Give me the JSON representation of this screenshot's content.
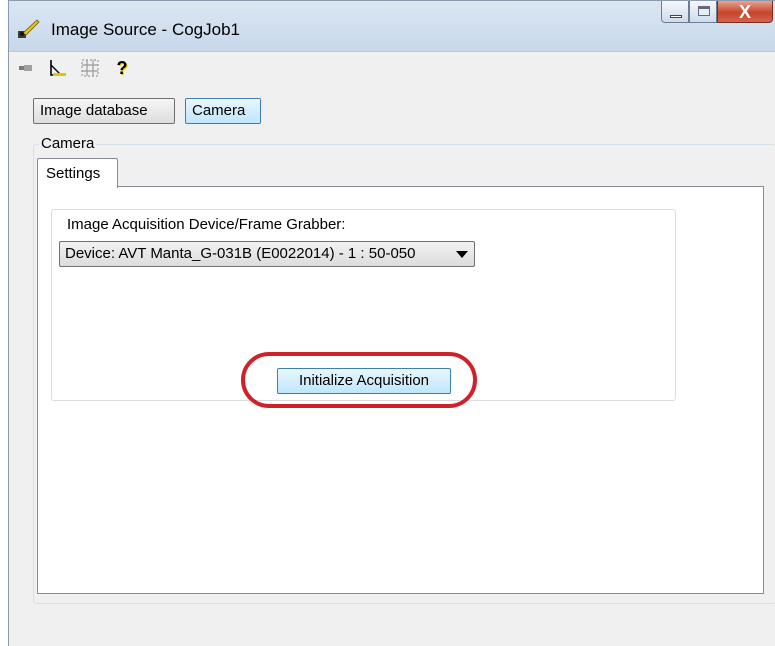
{
  "window": {
    "title": "Image Source - CogJob1",
    "close_label": "X"
  },
  "toolbar": {
    "icons": [
      "pin-icon",
      "ruler-icon",
      "grid-icon",
      "help-icon"
    ],
    "help_glyph": "?"
  },
  "source_buttons": {
    "image_database": "Image database",
    "camera": "Camera"
  },
  "camera_group": {
    "label": "Camera",
    "tabs": [
      {
        "label": "Settings"
      }
    ],
    "device_label": "Image Acquisition Device/Frame Grabber:",
    "device_value": "Device: AVT Manta_G-031B (E0022014) - 1 : 50-050",
    "initialize_button": "Initialize Acquisition"
  },
  "colors": {
    "highlight": "#d0202a",
    "selected_button": "#bee6fd"
  }
}
